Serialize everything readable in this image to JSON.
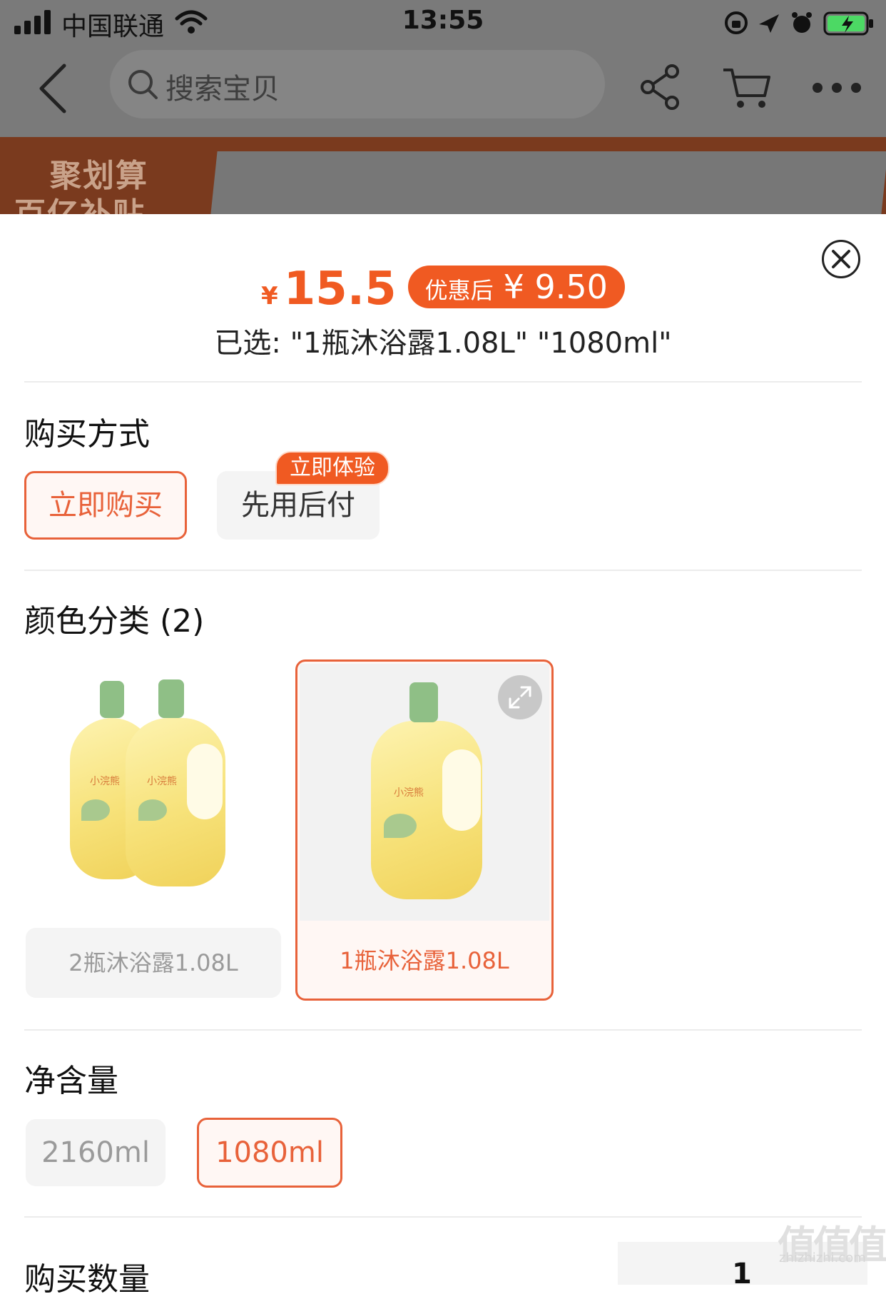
{
  "status_bar": {
    "carrier": "中国联通",
    "time": "13:55"
  },
  "nav": {
    "search_placeholder": "搜索宝贝"
  },
  "banner": {
    "line1": "聚划算",
    "line2": "百亿补贴"
  },
  "sheet": {
    "price_currency": "¥",
    "price": "15.5",
    "discount_label": "优惠后",
    "discount_value": "¥ 9.50",
    "selected_text": "已选: \"1瓶沐浴露1.08L\" \"1080ml\"",
    "purchase_method": {
      "title": "购买方式",
      "options": [
        {
          "label": "立即购买",
          "selected": true
        },
        {
          "label": "先用后付",
          "selected": false,
          "tag": "立即体验"
        }
      ]
    },
    "color_category": {
      "title": "颜色分类 (2)",
      "options": [
        {
          "label": "2瓶沐浴露1.08L",
          "selected": false,
          "brand": "小浣熊"
        },
        {
          "label": "1瓶沐浴露1.08L",
          "selected": true,
          "brand": "小浣熊"
        }
      ]
    },
    "net_content": {
      "title": "净含量",
      "options": [
        {
          "label": "2160ml",
          "selected": false
        },
        {
          "label": "1080ml",
          "selected": true
        }
      ]
    },
    "quantity": {
      "title": "购买数量",
      "value": "1"
    }
  },
  "watermark": {
    "main": "值值值",
    "sub": "zhizhizhi.com"
  },
  "colors": {
    "accent": "#f05a22",
    "selected_border": "#e8623a"
  }
}
